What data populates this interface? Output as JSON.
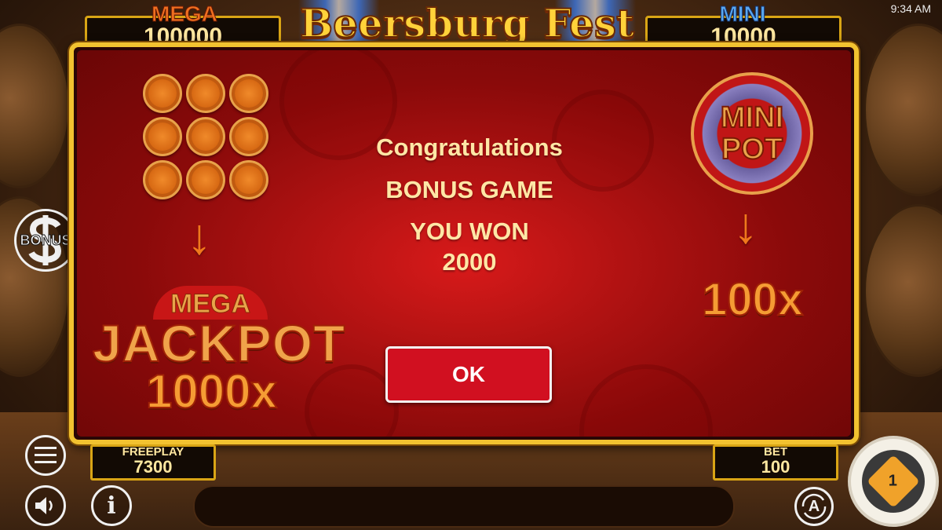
{
  "status_bar": {
    "time": "9:34 AM"
  },
  "header": {
    "logo_text": "Beersburg Fest",
    "mega": {
      "label": "MEGA",
      "value": "100000"
    },
    "mini": {
      "label": "MINI",
      "value": "10000"
    }
  },
  "side": {
    "bonus_label": "BONUS"
  },
  "modal": {
    "congrats": "Congratulations",
    "bonus_game": "BONUS GAME",
    "you_won": "YOU WON",
    "amount": "2000",
    "ok_label": "OK",
    "left_panel": {
      "mega_text": "MEGA",
      "jackpot_text": "JACKPOT",
      "multiplier": "1000x",
      "coin_count": 9
    },
    "right_panel": {
      "mini_text": "MINI",
      "pot_text": "POT",
      "multiplier": "100x"
    }
  },
  "hud": {
    "freeplay": {
      "label": "FREEPLAY",
      "value": "7300"
    },
    "bet": {
      "label": "BET",
      "value": "100"
    },
    "auto_label": "A",
    "spin_label": "1"
  },
  "colors": {
    "gold_border": "#f2c230",
    "modal_red": "#c01414",
    "ok_red": "#d11020",
    "mega_orange": "#f0781c",
    "mini_blue": "#5aa8f0"
  }
}
